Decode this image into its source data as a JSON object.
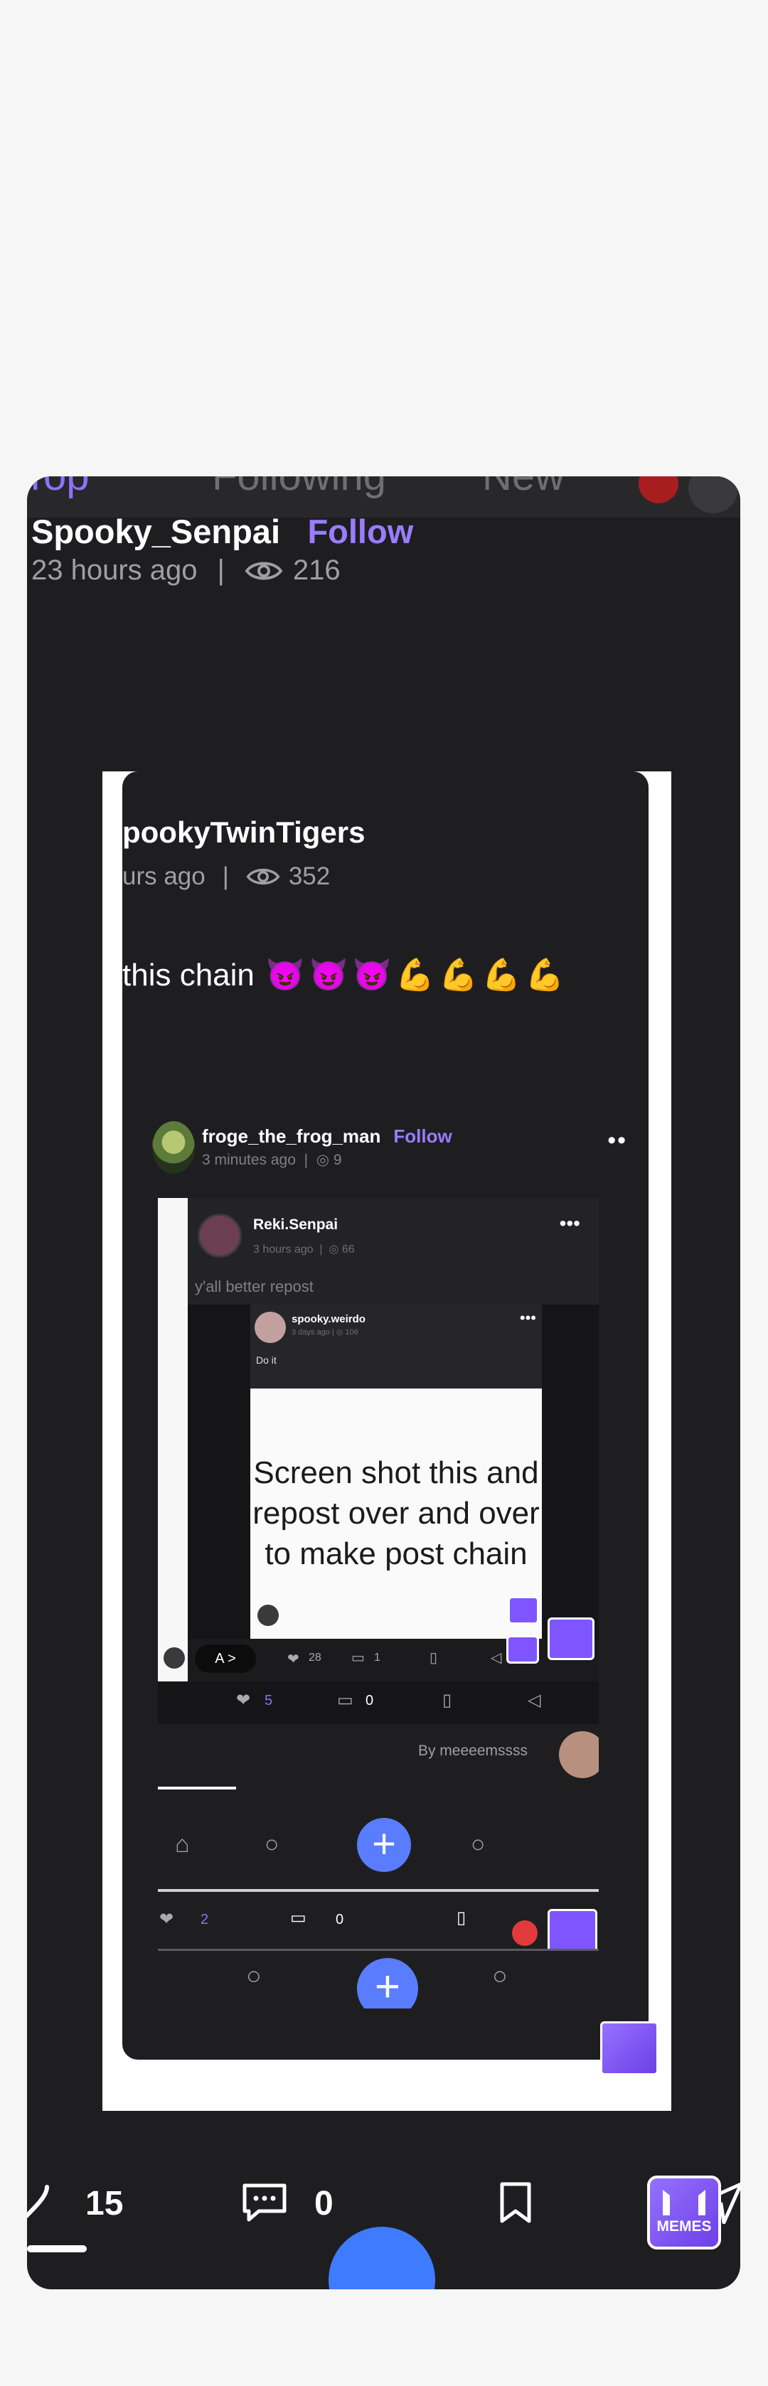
{
  "header": {
    "tabs": [
      "Top",
      "Following",
      "New"
    ],
    "author": "Spooky_Senpai",
    "follow_label": "Follow",
    "time": "23 hours ago",
    "separator": "|",
    "views": "216"
  },
  "screenshot": {
    "author": "pookyTwinTigers",
    "time": "urs ago",
    "separator": "|",
    "views": "352",
    "caption": "this chain",
    "caption_emoji": "😈😈😈💪💪💪💪",
    "repost": {
      "author": "froge_the_frog_man",
      "follow_label": "Follow",
      "time": "3 minutes ago",
      "views": "9",
      "reki": {
        "author": "Reki.Senpai",
        "time": "3 hours ago",
        "views": "66",
        "caption": "y'all better repost"
      },
      "spooky": {
        "author": "spooky.weirdo",
        "time": "3 days ago",
        "views": "106",
        "caption": "Do it",
        "image_text": "Screen shot this and repost over and over to make post chain"
      },
      "actions_inner": {
        "pill": "A >",
        "likes": "28",
        "comments": "1"
      },
      "actions_reki": {
        "likes": "5",
        "comments": "0"
      },
      "byline": "By meeeemssss",
      "actions_frog": {
        "likes": "2",
        "comments": "0"
      },
      "memes_label": "MEMES"
    }
  },
  "actions": {
    "likes": "15",
    "comments": "0"
  },
  "brand": {
    "memes_label": "MEMES",
    "accent": "#9a7cff",
    "fab_color": "#3f7bff"
  }
}
